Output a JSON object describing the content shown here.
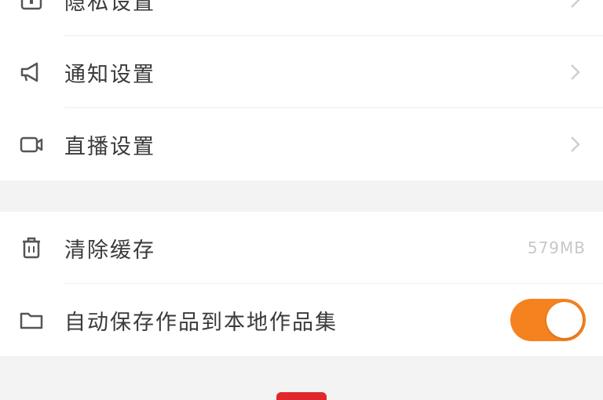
{
  "settings_group_1": [
    {
      "label": "隐私设置",
      "icon": "lock-icon"
    },
    {
      "label": "通知设置",
      "icon": "megaphone-icon"
    },
    {
      "label": "直播设置",
      "icon": "video-camera-icon"
    }
  ],
  "settings_group_2": {
    "clear_cache": {
      "label": "清除缓存",
      "value": "579MB",
      "icon": "trash-icon"
    },
    "auto_save": {
      "label": "自动保存作品到本地作品集",
      "enabled": true,
      "icon": "folder-icon"
    }
  },
  "colors": {
    "accent": "#f5821f",
    "bottom_mark": "#e0282c"
  }
}
